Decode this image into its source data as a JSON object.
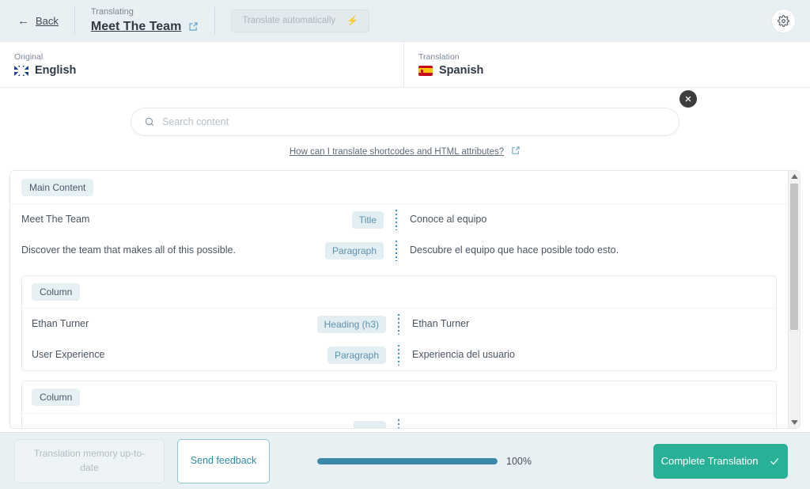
{
  "header": {
    "back_label": "Back",
    "back_arrow_icon": "arrow-left-icon",
    "translating_label": "Translating",
    "document_title": "Meet The Team",
    "external_link_icon": "external-link-icon",
    "auto_translate_label": "Translate automatically",
    "auto_translate_icon": "lightning-bolt-icon",
    "settings_icon": "gear-icon"
  },
  "languages": {
    "original_label": "Original",
    "original_language": "English",
    "original_flag_icon": "flag-united-kingdom-icon",
    "translation_label": "Translation",
    "translation_language": "Spanish",
    "translation_flag_icon": "flag-spain-icon"
  },
  "search": {
    "placeholder": "Search content",
    "value": "",
    "search_icon": "search-icon",
    "close_icon": "close-icon",
    "help_text": "How can I translate shortcodes and HTML attributes?",
    "help_icon": "external-link-icon"
  },
  "content": {
    "group_label": "Main Content",
    "segments": [
      {
        "source": "Meet The Team",
        "type": "Title",
        "target": "Conoce al equipo"
      },
      {
        "source": "Discover the team that makes all of this possible.",
        "type": "Paragraph",
        "target": "Descubre el equipo que hace posible todo esto."
      }
    ],
    "columns": [
      {
        "label": "Column",
        "segments": [
          {
            "source": "Ethan Turner",
            "type": "Heading (h3)",
            "target": "Ethan Turner"
          },
          {
            "source": "User Experience",
            "type": "Paragraph",
            "target": "Experiencia del usuario"
          }
        ]
      },
      {
        "label": "Column",
        "segments": []
      }
    ],
    "scrollbar": {
      "up_icon": "scroll-up-arrow-icon",
      "down_icon": "scroll-down-arrow-icon"
    }
  },
  "footer": {
    "translation_memory_label": "Translation memory up-to-date",
    "send_feedback_label": "Send feedback",
    "progress_percent": "100%",
    "progress_value": 100,
    "complete_label": "Complete Translation",
    "complete_icon": "check-icon"
  },
  "colors": {
    "header_bg": "#e9f0f3",
    "accent_teal": "#29b197",
    "progress_blue": "#3b88a8",
    "badge_text": "#5c91ac",
    "badge_bg": "#e3eef3",
    "tag_bg": "#e7f0f3",
    "feedback_border": "#8fc4cf"
  }
}
